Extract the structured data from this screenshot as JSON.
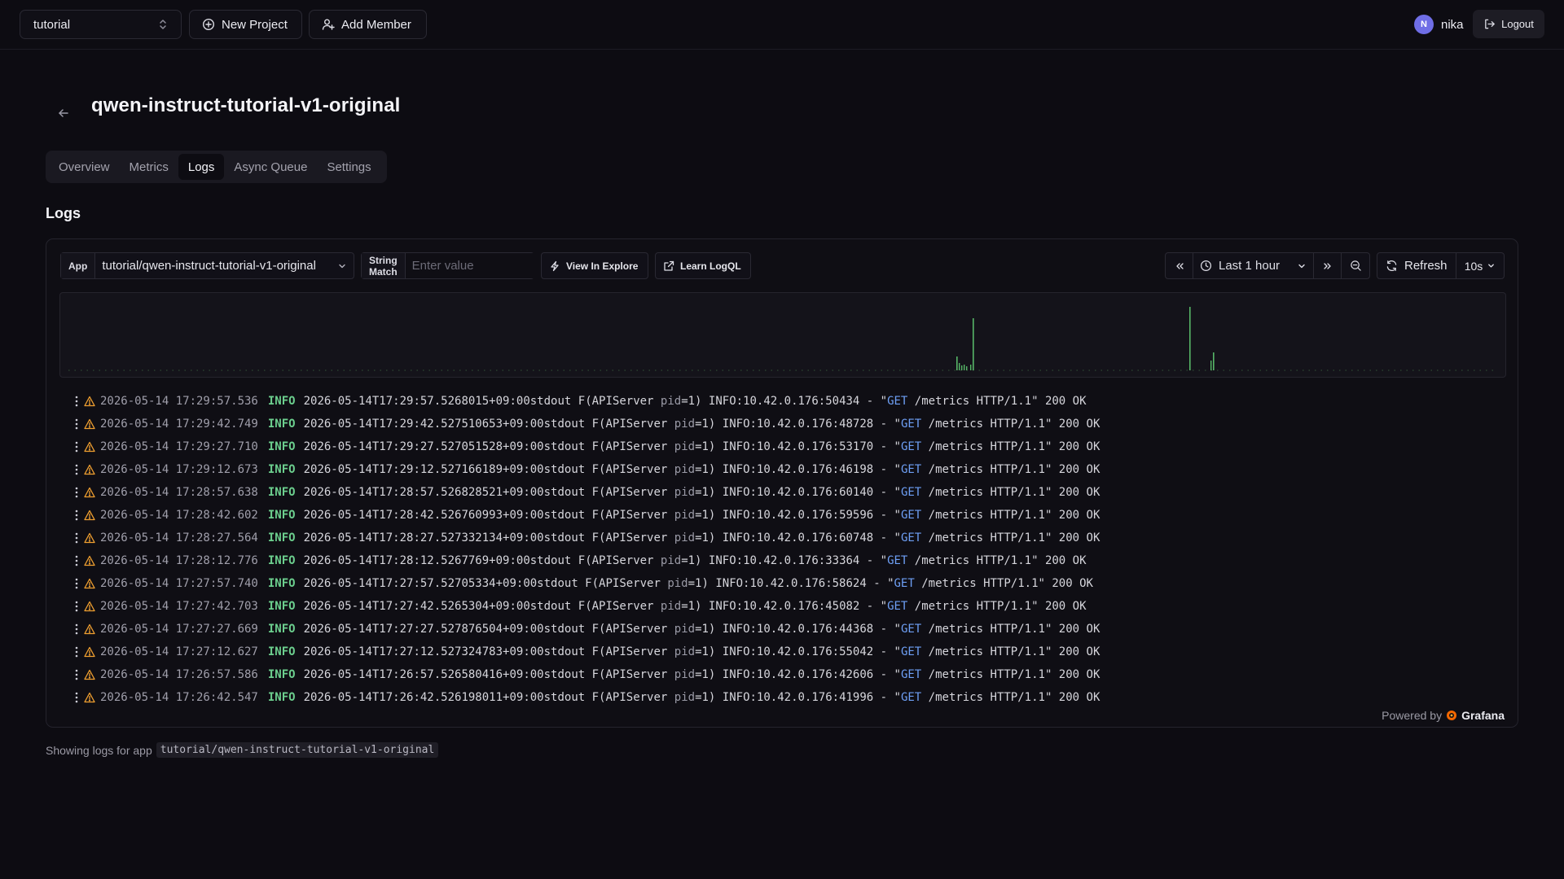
{
  "topbar": {
    "project": "tutorial",
    "new_project_label": "New Project",
    "add_member_label": "Add Member",
    "user_initial": "N",
    "user_name": "nika",
    "logout_label": "Logout"
  },
  "page": {
    "title": "qwen-instruct-tutorial-v1-original",
    "tabs": [
      "Overview",
      "Metrics",
      "Logs",
      "Async Queue",
      "Settings"
    ],
    "active_tab": "Logs",
    "section_title": "Logs"
  },
  "controls": {
    "app_label": "App",
    "app_value": "tutorial/qwen-instruct-tutorial-v1-original",
    "string_match_label": "String Match",
    "string_match_placeholder": "Enter value",
    "view_in_explore_label": "View In Explore",
    "learn_logql_label": "Learn LogQL",
    "time_range": "Last 1 hour",
    "refresh_label": "Refresh",
    "refresh_interval": "10s"
  },
  "logs": [
    {
      "ts": "2026-05-14 17:29:57.536",
      "level": "INFO",
      "iso": "2026-05-14T17:29:57.5268015+09:00",
      "addr": "10.42.0.176:50434"
    },
    {
      "ts": "2026-05-14 17:29:42.749",
      "level": "INFO",
      "iso": "2026-05-14T17:29:42.527510653+09:00",
      "addr": "10.42.0.176:48728"
    },
    {
      "ts": "2026-05-14 17:29:27.710",
      "level": "INFO",
      "iso": "2026-05-14T17:29:27.527051528+09:00",
      "addr": "10.42.0.176:53170"
    },
    {
      "ts": "2026-05-14 17:29:12.673",
      "level": "INFO",
      "iso": "2026-05-14T17:29:12.527166189+09:00",
      "addr": "10.42.0.176:46198"
    },
    {
      "ts": "2026-05-14 17:28:57.638",
      "level": "INFO",
      "iso": "2026-05-14T17:28:57.526828521+09:00",
      "addr": "10.42.0.176:60140"
    },
    {
      "ts": "2026-05-14 17:28:42.602",
      "level": "INFO",
      "iso": "2026-05-14T17:28:42.526760993+09:00",
      "addr": "10.42.0.176:59596"
    },
    {
      "ts": "2026-05-14 17:28:27.564",
      "level": "INFO",
      "iso": "2026-05-14T17:28:27.527332134+09:00",
      "addr": "10.42.0.176:60748"
    },
    {
      "ts": "2026-05-14 17:28:12.776",
      "level": "INFO",
      "iso": "2026-05-14T17:28:12.5267769+09:00",
      "addr": "10.42.0.176:33364"
    },
    {
      "ts": "2026-05-14 17:27:57.740",
      "level": "INFO",
      "iso": "2026-05-14T17:27:57.52705334+09:00",
      "addr": "10.42.0.176:58624"
    },
    {
      "ts": "2026-05-14 17:27:42.703",
      "level": "INFO",
      "iso": "2026-05-14T17:27:42.5265304+09:00",
      "addr": "10.42.0.176:45082"
    },
    {
      "ts": "2026-05-14 17:27:27.669",
      "level": "INFO",
      "iso": "2026-05-14T17:27:27.527876504+09:00",
      "addr": "10.42.0.176:44368"
    },
    {
      "ts": "2026-05-14 17:27:12.627",
      "level": "INFO",
      "iso": "2026-05-14T17:27:12.527324783+09:00",
      "addr": "10.42.0.176:55042"
    },
    {
      "ts": "2026-05-14 17:26:57.586",
      "level": "INFO",
      "iso": "2026-05-14T17:26:57.526580416+09:00",
      "addr": "10.42.0.176:42606"
    },
    {
      "ts": "2026-05-14 17:26:42.547",
      "level": "INFO",
      "iso": "2026-05-14T17:26:42.526198011+09:00",
      "addr": "10.42.0.176:41996"
    }
  ],
  "log_template": {
    "stream": "stdout F",
    "server_prefix": "(APIServer ",
    "pid_label": "pid",
    "pid_value": "=1) INFO:",
    "dash": " - \"",
    "method": "GET",
    "request_tail": " /metrics HTTP/1.1\" 200 OK"
  },
  "powered_by": {
    "prefix": "Powered by",
    "brand": "Grafana"
  },
  "footer": {
    "prefix": "Showing logs for app",
    "app": "tutorial/qwen-instruct-tutorial-v1-original"
  },
  "colors": {
    "level_info": "#6ccf8e",
    "method": "#6e9ff5",
    "warning": "#f0a030",
    "histogram_bar": "#56b667",
    "avatar": "#6f6ee6"
  }
}
